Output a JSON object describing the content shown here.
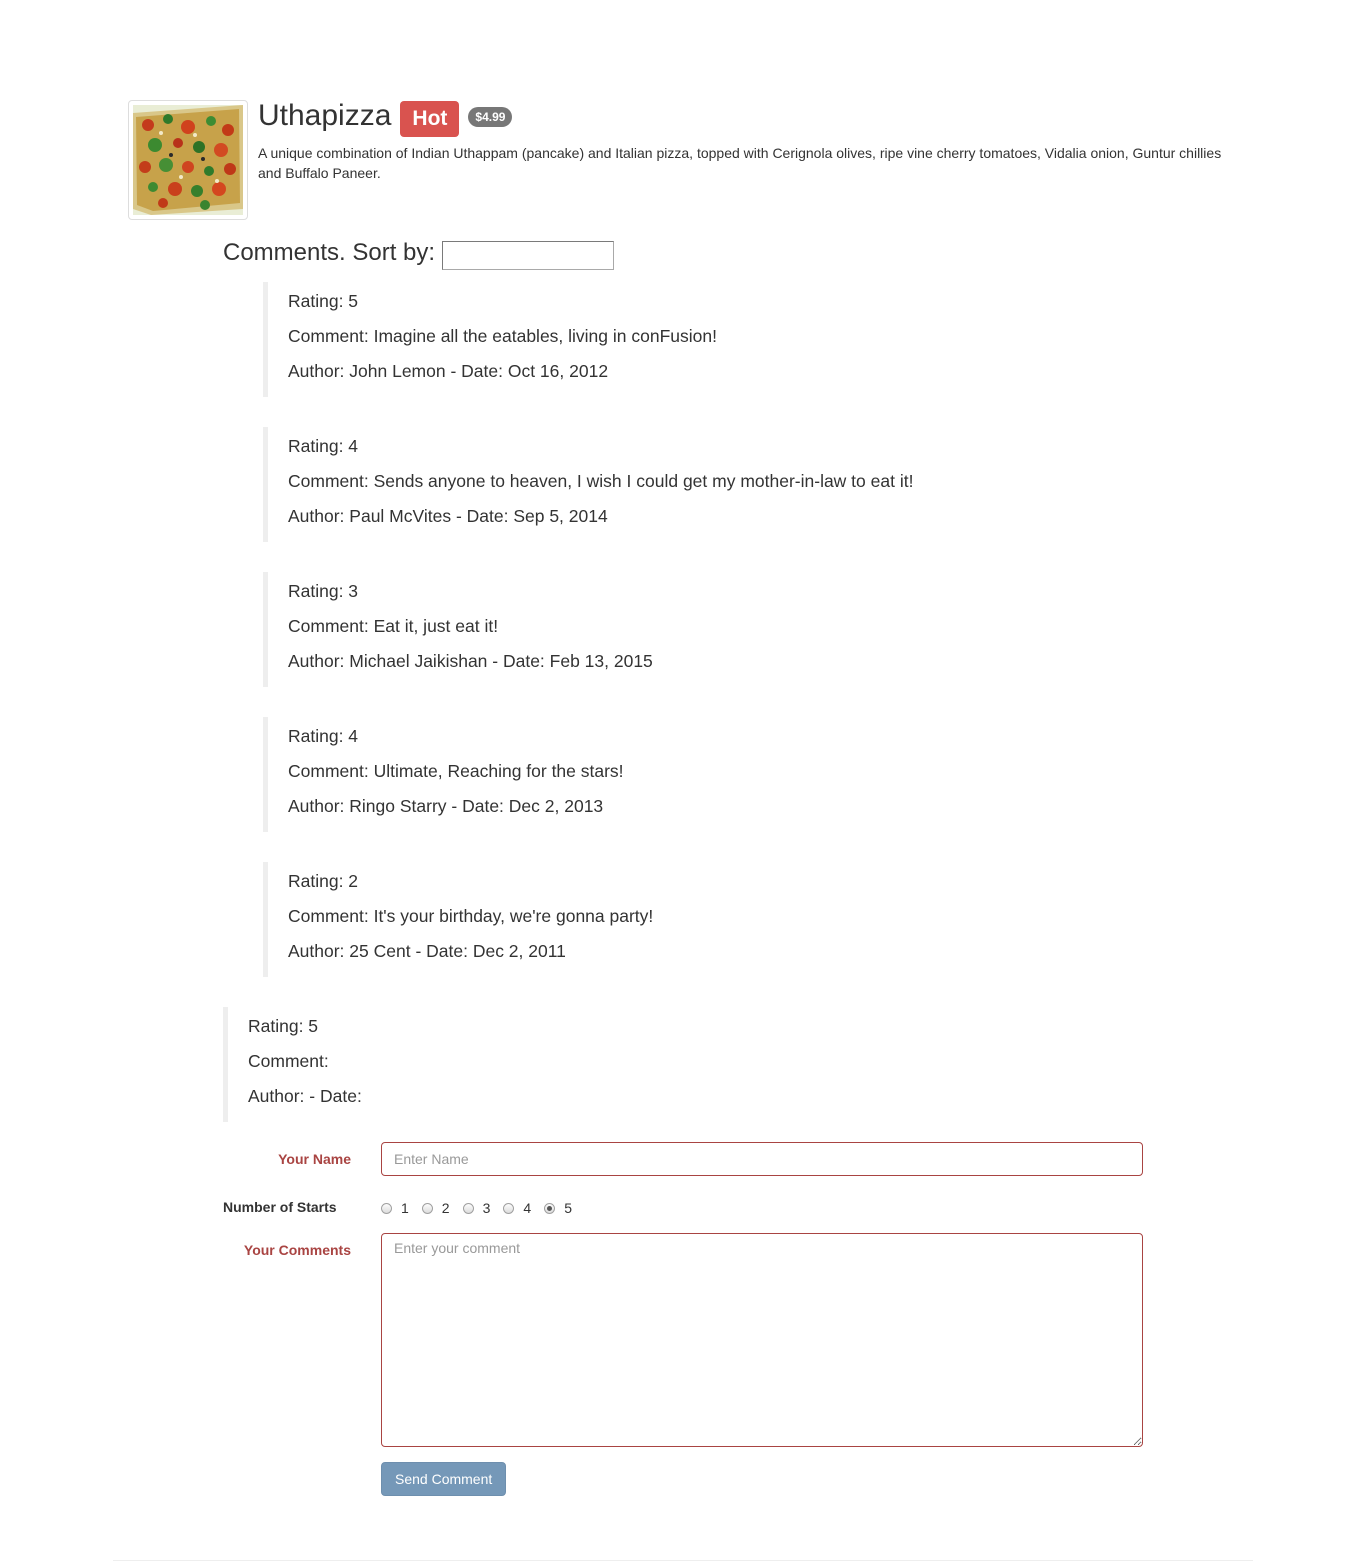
{
  "dish": {
    "name": "Uthapizza",
    "label": "Hot",
    "price": "$4.99",
    "description": "A unique combination of Indian Uthappam (pancake) and Italian pizza, topped with Cerignola olives, ripe vine cherry tomatoes, Vidalia onion, Guntur chillies and Buffalo Paneer.",
    "image_alt": "Uthapizza"
  },
  "comments_section": {
    "heading": "Comments. Sort by:",
    "sort_value": ""
  },
  "comments": [
    {
      "rating": "Rating: 5",
      "comment": "Comment: Imagine all the eatables, living in conFusion!",
      "author": "Author: John Lemon - Date: Oct 16, 2012"
    },
    {
      "rating": "Rating: 4",
      "comment": "Comment: Sends anyone to heaven, I wish I could get my mother-in-law to eat it!",
      "author": "Author: Paul McVites - Date: Sep 5, 2014"
    },
    {
      "rating": "Rating: 3",
      "comment": "Comment: Eat it, just eat it!",
      "author": "Author: Michael Jaikishan - Date: Feb 13, 2015"
    },
    {
      "rating": "Rating: 4",
      "comment": "Comment: Ultimate, Reaching for the stars!",
      "author": "Author: Ringo Starry - Date: Dec 2, 2013"
    },
    {
      "rating": "Rating: 2",
      "comment": "Comment: It's your birthday, we're gonna party!",
      "author": "Author: 25 Cent - Date: Dec 2, 2011"
    }
  ],
  "preview": {
    "rating": "Rating: 5",
    "comment": "Comment:",
    "author": "Author: - Date:"
  },
  "form": {
    "name_label": "Your Name",
    "name_placeholder": "Enter Name",
    "name_value": "",
    "stars_label": "Number of Starts",
    "star_options": [
      "1",
      "2",
      "3",
      "4",
      "5"
    ],
    "selected_star": "5",
    "comments_label": "Your Comments",
    "comments_placeholder": "Enter your comment",
    "submit_label": "Send Comment"
  },
  "colors": {
    "hot_label": "#d9534f",
    "price_badge": "#777777",
    "error": "#a94442",
    "submit_button": "#7598b8"
  }
}
